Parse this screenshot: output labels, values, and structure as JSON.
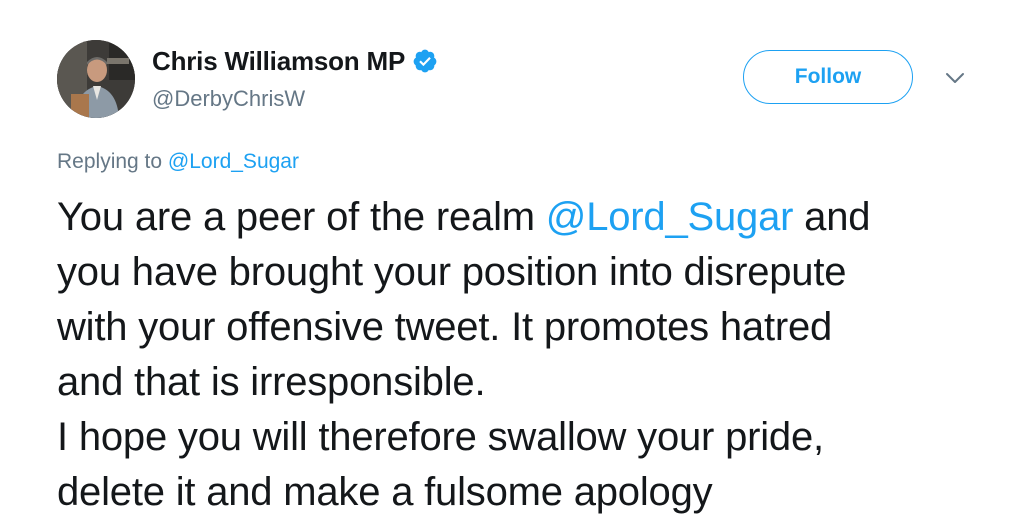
{
  "author": {
    "display_name": "Chris Williamson MP",
    "handle": "@DerbyChrisW",
    "verified": true,
    "avatar_icon": "profile-photo"
  },
  "actions": {
    "follow_label": "Follow",
    "menu_icon": "chevron-down-icon"
  },
  "reply": {
    "prefix": "Replying to ",
    "to_handle": "@Lord_Sugar"
  },
  "tweet": {
    "line1_before": "You are a peer of the realm ",
    "line1_mention": "@Lord_Sugar",
    "line1_after": " and",
    "line2": "you have brought your position into disrepute",
    "line3": "with your offensive tweet. It promotes hatred",
    "line4": "and that is irresponsible.",
    "line5": "I hope you will therefore swallow your pride,",
    "line6": "delete it and make a fulsome apology"
  },
  "colors": {
    "link": "#1da1f2",
    "text": "#14171a",
    "secondary": "#657786"
  }
}
